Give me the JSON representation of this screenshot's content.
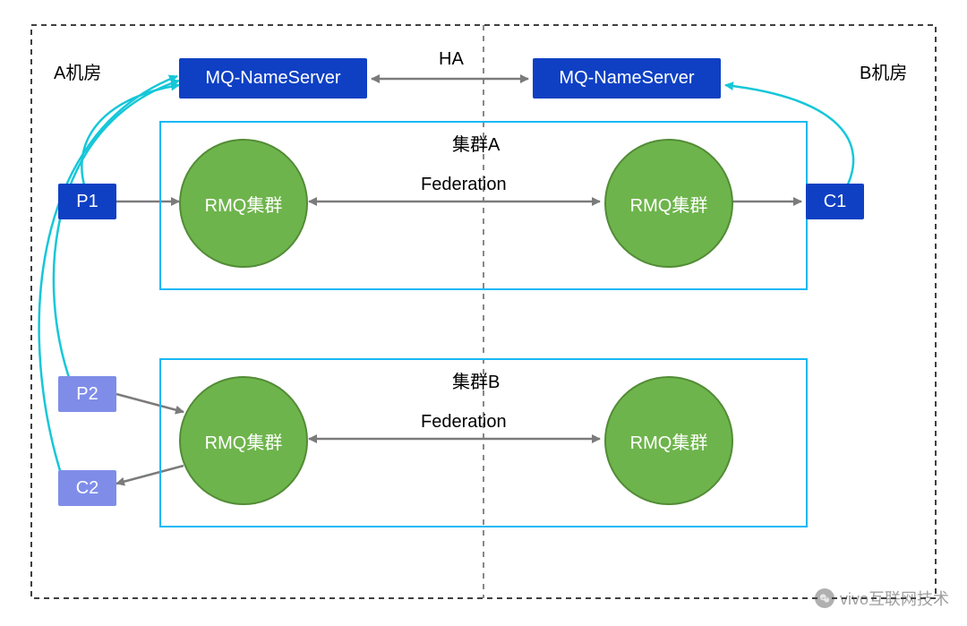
{
  "datacenter": {
    "left_label": "A机房",
    "right_label": "B机房"
  },
  "nameservers": {
    "left": "MQ-NameServer",
    "right": "MQ-NameServer",
    "link_label": "HA"
  },
  "cluster_a": {
    "title": "集群A",
    "left_node": "RMQ集群",
    "right_node": "RMQ集群",
    "link_label": "Federation"
  },
  "cluster_b": {
    "title": "集群B",
    "left_node": "RMQ集群",
    "right_node": "RMQ集群",
    "link_label": "Federation"
  },
  "clients": {
    "p1": "P1",
    "c1": "C1",
    "p2": "P2",
    "c2": "C2"
  },
  "watermark": {
    "text": "vivo互联网技术"
  },
  "colors": {
    "blue": "#0f40c4",
    "light_blue": "#7f8de9",
    "green": "#6eb44c",
    "cyan_border": "#18b8f5",
    "arrow_gray": "#7b7b7b",
    "arrow_cyan": "#15c7d8"
  }
}
